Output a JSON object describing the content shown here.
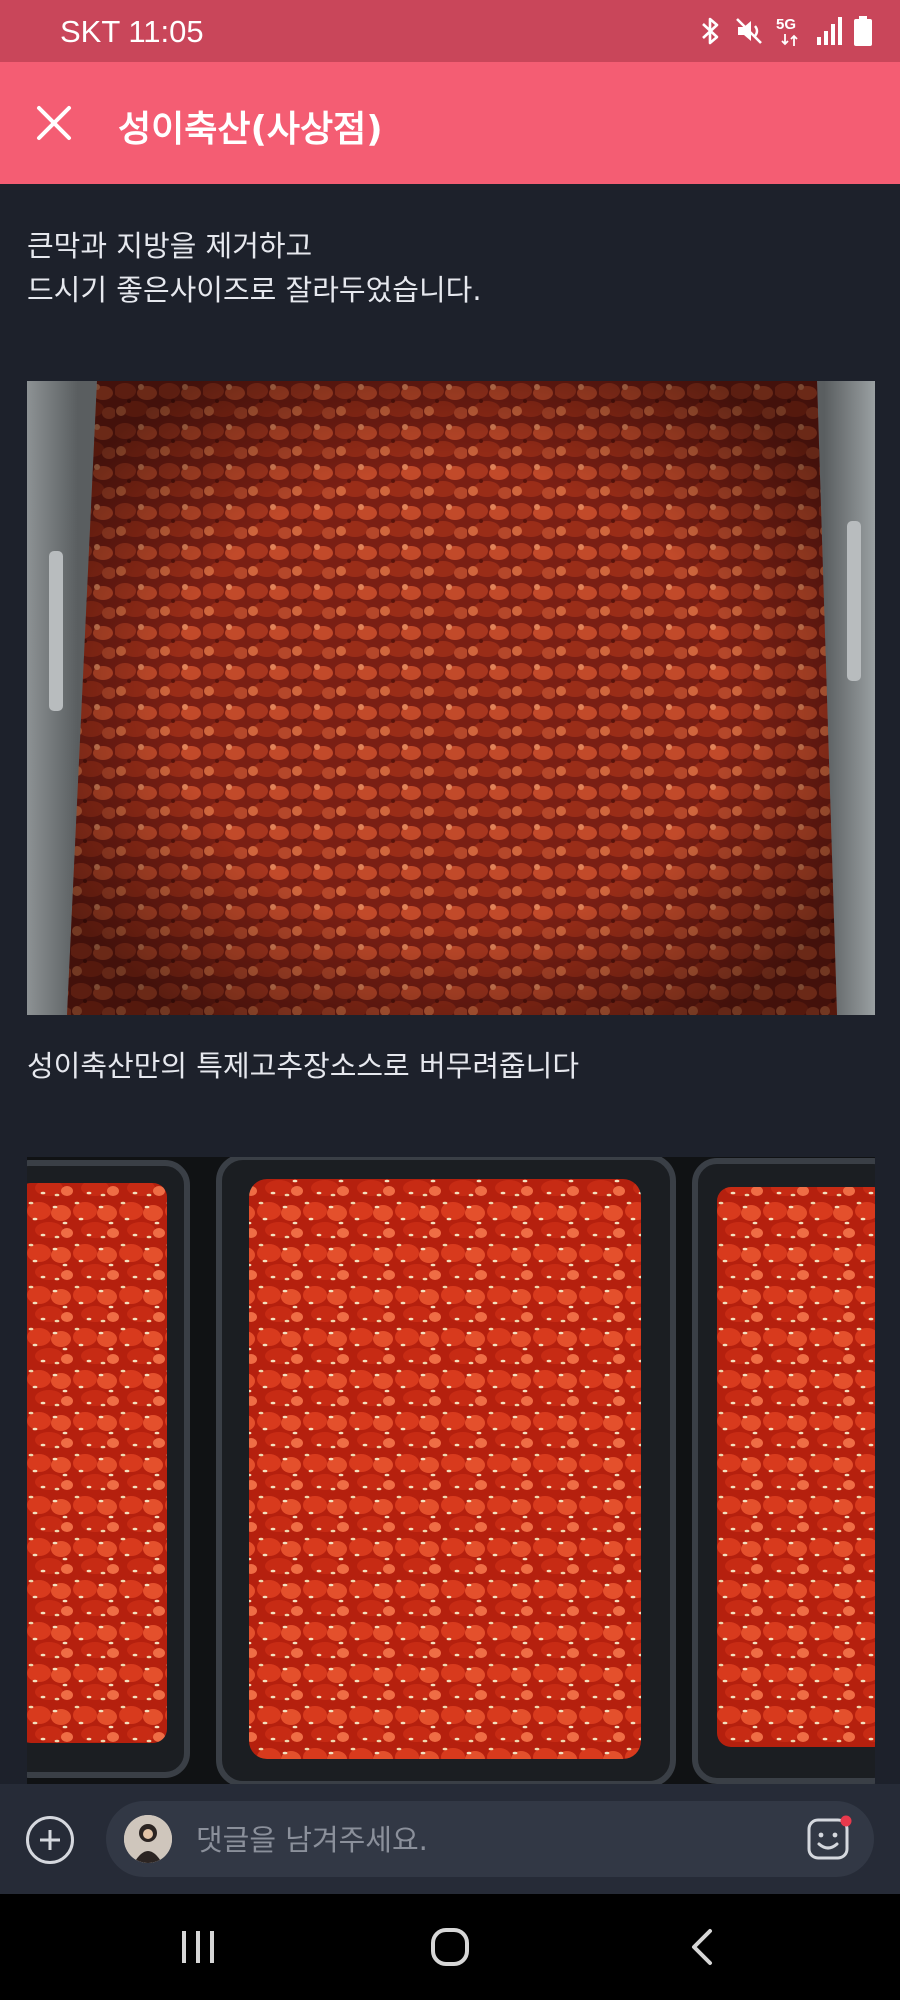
{
  "status_bar": {
    "carrier_time": "SKT 11:05",
    "network_label": "5G",
    "icons": [
      "bluetooth-icon",
      "vibrate-mute-icon",
      "5g-icon",
      "signal-icon",
      "battery-icon"
    ]
  },
  "app_bar": {
    "title": "성이축산(사상점)",
    "close_icon": "close-icon",
    "background": "#f45d73"
  },
  "post": {
    "paragraph_1_line_1": "큰막과 지방을 제거하고",
    "paragraph_1_line_2": "드시기 좋은사이즈로 잘라두었습니다.",
    "photo_1": "marinated-pork-in-steel-tray-photo",
    "paragraph_2": "성이축산만의 특제고추장소스로 버무려줍니다",
    "photo_2": "spicy-pork-in-black-containers-with-sesame-photo"
  },
  "comment_bar": {
    "placeholder": "댓글을 남겨주세요.",
    "add_icon": "plus-circle-icon",
    "emoji_icon": "emoji-icon",
    "notification_dot_color": "#e8394c"
  },
  "nav_bar": {
    "icons": [
      "recent-apps-icon",
      "home-icon",
      "back-icon"
    ]
  }
}
